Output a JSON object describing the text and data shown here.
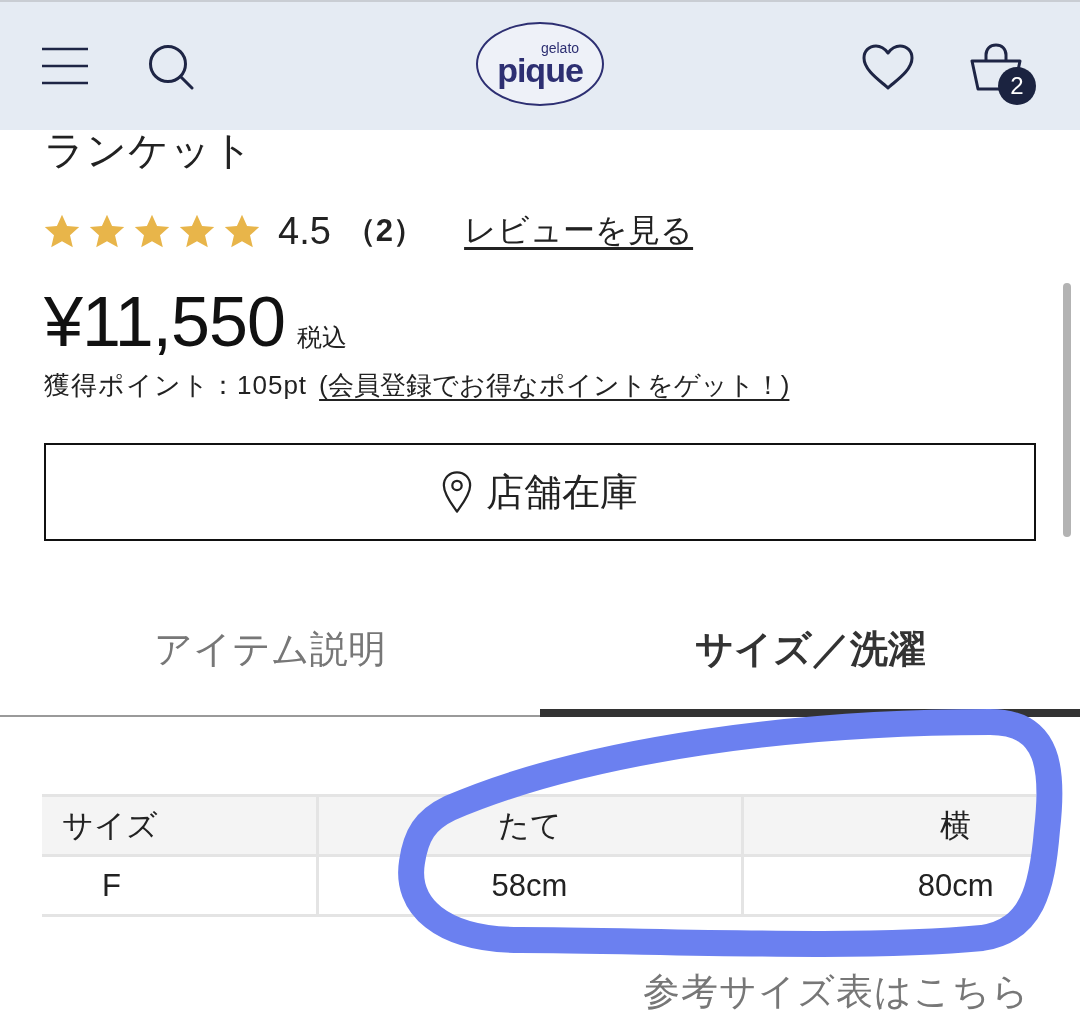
{
  "header": {
    "logo": {
      "tagline": "gelato",
      "wordmark": "pique"
    },
    "cart_count": "2"
  },
  "product": {
    "title": "ランケット",
    "rating": {
      "stars": 5,
      "score": "4.5",
      "count": "（2）",
      "reviews_link": "レビューを見る"
    },
    "price": "¥11,550",
    "tax_note": "税込",
    "points": "獲得ポイント：105pt",
    "points_link": "(会員登録でお得なポイントをゲット！)"
  },
  "store_stock_button": "店舗在庫",
  "tabs": [
    {
      "label": "アイテム説明",
      "selected": false
    },
    {
      "label": "サイズ／洗濯",
      "selected": true
    }
  ],
  "size_table": {
    "columns": [
      "サイズ",
      "たて",
      "横"
    ],
    "rows": [
      [
        "F",
        "58cm",
        "80cm"
      ]
    ]
  },
  "size_chart_link": "参考サイズ表はこちら"
}
